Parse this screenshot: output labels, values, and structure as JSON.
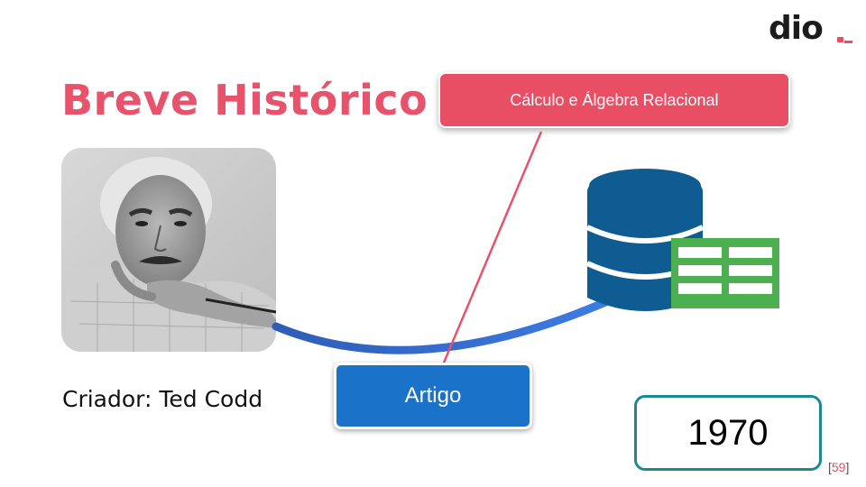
{
  "brand": {
    "logo_text": "dio",
    "logo_accent": "#e84f64"
  },
  "slide": {
    "title": "Breve Histórico",
    "calc_box_label": "Cálculo e Álgebra Relacional",
    "caption": "Criador: Ted Codd",
    "artigo_label": "Artigo",
    "year": "1970",
    "page_number": "59"
  },
  "colors": {
    "title": "#e8526b",
    "calc_box": "#e84f64",
    "artigo_box": "#1a73c8",
    "year_border": "#1a8a90",
    "database": "#0f5c93",
    "table_icon": "#4caf50"
  },
  "icons": [
    "database-icon",
    "spreadsheet-icon",
    "dio-logo"
  ]
}
